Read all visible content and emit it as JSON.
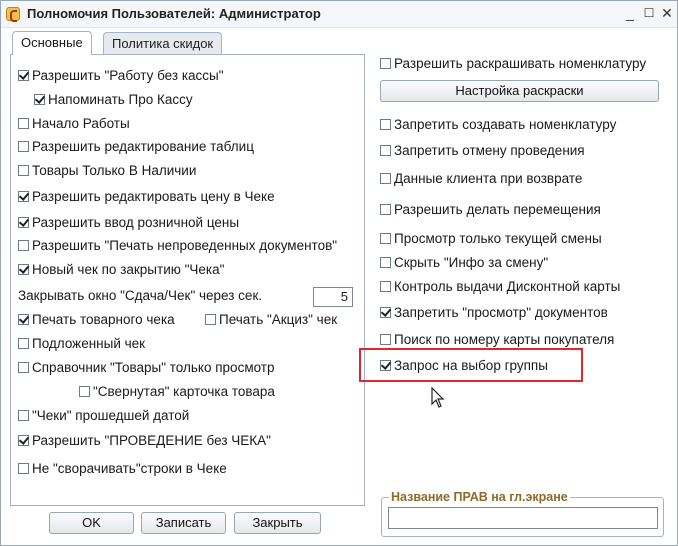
{
  "window": {
    "title": "Полномочия Пользователей: Администратор"
  },
  "tabs": [
    {
      "label": "Основные",
      "active": true
    },
    {
      "label": "Политика скидок",
      "active": false
    }
  ],
  "left": {
    "items": [
      {
        "label": "Разрешить \"Работу без кассы\"",
        "checked": true
      },
      {
        "label": "Напоминать Про Кассу",
        "checked": true
      },
      {
        "label": "Начало Работы",
        "checked": false
      },
      {
        "label": "Разрешить редактирование таблиц",
        "checked": false
      },
      {
        "label": "Товары Только В Наличии",
        "checked": false
      },
      {
        "label": "Разрешить редактировать цену в Чеке",
        "checked": true
      },
      {
        "label": "Разрешить ввод розничной цены",
        "checked": true
      },
      {
        "label": "Разрешить \"Печать непроведенных документов\"",
        "checked": false
      },
      {
        "label": "Новый чек по закрытию \"Чека\"",
        "checked": true
      },
      {
        "label": "Печать товарного чека",
        "checked": true
      },
      {
        "label": "Печать \"Акциз\" чек",
        "checked": false
      },
      {
        "label": "Подложенный чек",
        "checked": false
      },
      {
        "label": "Справочник \"Товары\" только просмотр",
        "checked": false
      },
      {
        "label": "\"Свернутая\" карточка товара",
        "checked": false
      },
      {
        "label": "\"Чеки\" прошедшей датой",
        "checked": false
      },
      {
        "label": "Разрешить \"ПРОВЕДЕНИЕ без ЧЕКА\"",
        "checked": true
      },
      {
        "label": "Не \"сворачивать\"строки в Чеке",
        "checked": false
      }
    ],
    "close_window_label": "Закрывать окно \"Сдача/Чек\" через сек.",
    "close_window_value": "5"
  },
  "right": {
    "items": [
      {
        "label": "Разрешить раскрашивать номенклатуру",
        "checked": false
      },
      {
        "label": "Запретить создавать номенклатуру",
        "checked": false
      },
      {
        "label": "Запретить отмену проведения",
        "checked": false
      },
      {
        "label": "Данные клиента при возврате",
        "checked": false
      },
      {
        "label": "Разрешить делать перемещения",
        "checked": false
      },
      {
        "label": "Просмотр только текущей смены",
        "checked": false
      },
      {
        "label": "Скрыть \"Инфо за смену\"",
        "checked": false
      },
      {
        "label": "Контроль выдачи Дисконтной карты",
        "checked": false
      },
      {
        "label": "Запретить \"просмотр\" документов",
        "checked": true
      },
      {
        "label": "Поиск по номеру карты покупателя",
        "checked": false
      },
      {
        "label": "Запрос на выбор группы",
        "checked": true
      }
    ],
    "color_settings_button": "Настройка раскраски",
    "rights_name_label": "Название ПРАВ на гл.экране",
    "rights_name_value": ""
  },
  "buttons": {
    "ok": "OK",
    "save": "Записать",
    "close": "Закрыть"
  },
  "colors": {
    "highlight": "#e0262f",
    "group_label": "#8b6a2b"
  }
}
